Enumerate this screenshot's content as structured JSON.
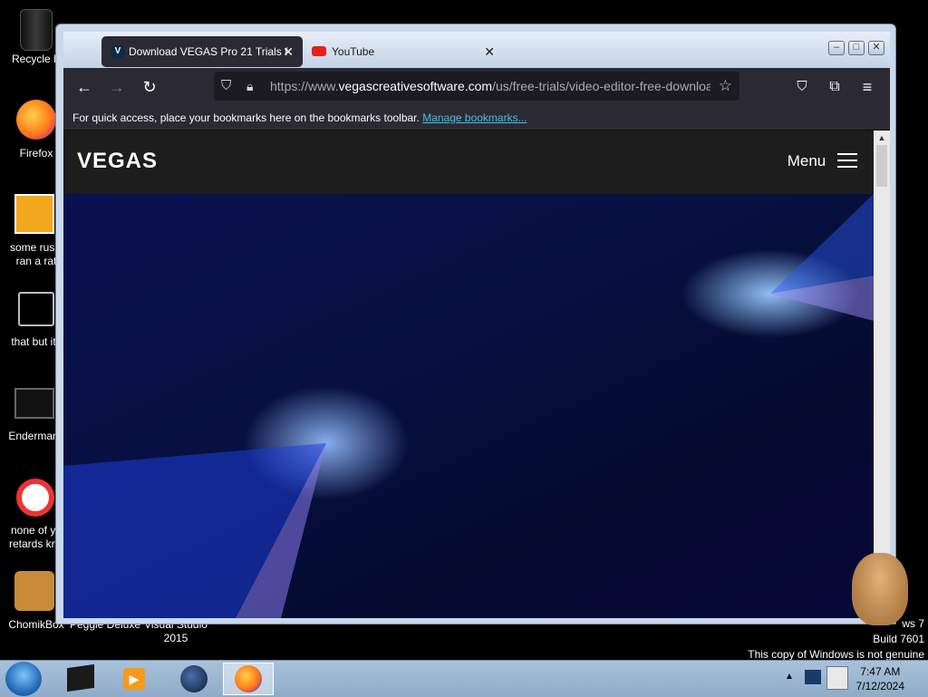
{
  "desktop": {
    "icons": [
      {
        "name": "recycle-bin",
        "label": "Recycle B"
      },
      {
        "name": "firefox",
        "label": "Firefox"
      },
      {
        "name": "file-1",
        "label": "some russi\nran a rat"
      },
      {
        "name": "file-2",
        "label": "that but its"
      },
      {
        "name": "endermanch",
        "label": "Endermanc"
      },
      {
        "name": "file-3",
        "label": "none of yo\nretards kno"
      },
      {
        "name": "chomikbox",
        "label": "ChomikBox"
      },
      {
        "name": "peggle",
        "label": "Peggle Deluxe"
      },
      {
        "name": "visual-studio",
        "label": "Visual Studio\n2015"
      }
    ],
    "watermark": {
      "line1": "ws 7",
      "line2": "Build 7601",
      "line3": "This copy of Windows is not genuine"
    }
  },
  "browser": {
    "tabs": [
      {
        "title": "Download VEGAS Pro 21 Trials f",
        "favicon": "V",
        "active": true
      },
      {
        "title": "YouTube",
        "active": false
      }
    ],
    "url": {
      "prefix": "https://www.",
      "domain": "vegascreativesoftware.com",
      "path": "/us/free-trials/video-editor-free-download"
    },
    "bookmarks_bar": {
      "text": "For quick access, place your bookmarks here on the bookmarks toolbar.",
      "link": "Manage bookmarks..."
    }
  },
  "site": {
    "logo": "VEGAS",
    "menu_label": "Menu"
  },
  "taskbar": {
    "time": "7:47 AM",
    "date": "7/12/2024"
  }
}
